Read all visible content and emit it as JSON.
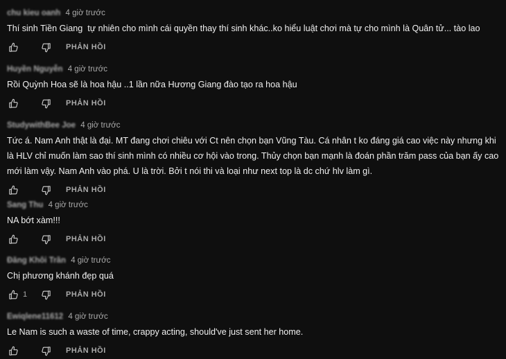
{
  "comments": [
    {
      "author": "chu kieu oanh",
      "time": "4 giờ trước",
      "text": "Thí sinh Tiền Giang  tự nhiên cho mình cái quyền thay thí sinh khác..ko hiểu luật chơi mà tự cho mình là Quân tử... tào lao",
      "likes": "",
      "reply_label": "PHẢN HỒI"
    },
    {
      "author": "Huyền Nguyễn",
      "time": "4 giờ trước",
      "text": "Rồi Quỳnh Hoa sẽ là hoa hậu ..1 lần nữa Hương Giang đào tạo ra hoa hậu",
      "likes": "",
      "reply_label": "PHẢN HỒI"
    },
    {
      "author": "StudywithBee Joe",
      "time": "4 giờ trước",
      "text": "Tức á. Nam Anh thật là đại. MT đang chơi chiêu với Ct nên chọn bạn Vũng Tàu. Cá nhân t ko đáng giá cao việc này nhưng khi là HLV chỉ muốn làm sao thí sinh mình có nhiều cơ hội vào trong. Thủy chọn bạn mạnh là đoán phần trăm pass của bạn ấy cao mới làm vậy. Nam Anh vào phá. U là trời. Bởi t nói thi và loại như next top là dc chứ hlv làm gì.",
      "likes": "",
      "reply_label": "PHẢN HỒI"
    },
    {
      "author": "Sang Thu",
      "time": "4 giờ trước",
      "text": "NA bớt xàm!!!",
      "likes": "",
      "reply_label": "PHẢN HỒI"
    },
    {
      "author": "Đăng Khôi Trần",
      "time": "4 giờ trước",
      "text": "Chị phương khánh đẹp quá",
      "likes": "1",
      "reply_label": "PHẢN HỒI"
    },
    {
      "author": "Ewiqlene11612",
      "time": "4 giờ trước",
      "text": "Le Nam is such a waste of time, crappy acting, should've just sent her home.",
      "likes": "",
      "reply_label": "PHẢN HỒI"
    }
  ],
  "icons": {
    "like": "thumbs-up-icon",
    "dislike": "thumbs-down-icon"
  },
  "colors": {
    "background": "#0f0f0f",
    "text": "#f1f1f1",
    "secondary": "#aaaaaa"
  }
}
